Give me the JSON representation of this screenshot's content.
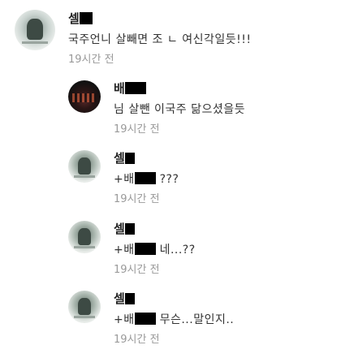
{
  "comments": [
    {
      "author": "셀",
      "text": "국주언니 살빼면 조 ㄴ 여신각일듯!!!",
      "time": "19시간 전"
    },
    {
      "author": "배",
      "text": "님 살뺀 이국주 닮으셨을듯",
      "time": "19시간 전"
    },
    {
      "author": "셀",
      "mention": "+배",
      "text": "???",
      "time": "19시간 전"
    },
    {
      "author": "셀",
      "mention": "+배",
      "text": "네...??",
      "time": "19시간 전"
    },
    {
      "author": "셀",
      "mention": "+배",
      "text": "무슨...말인지..",
      "time": "19시간 전"
    }
  ]
}
